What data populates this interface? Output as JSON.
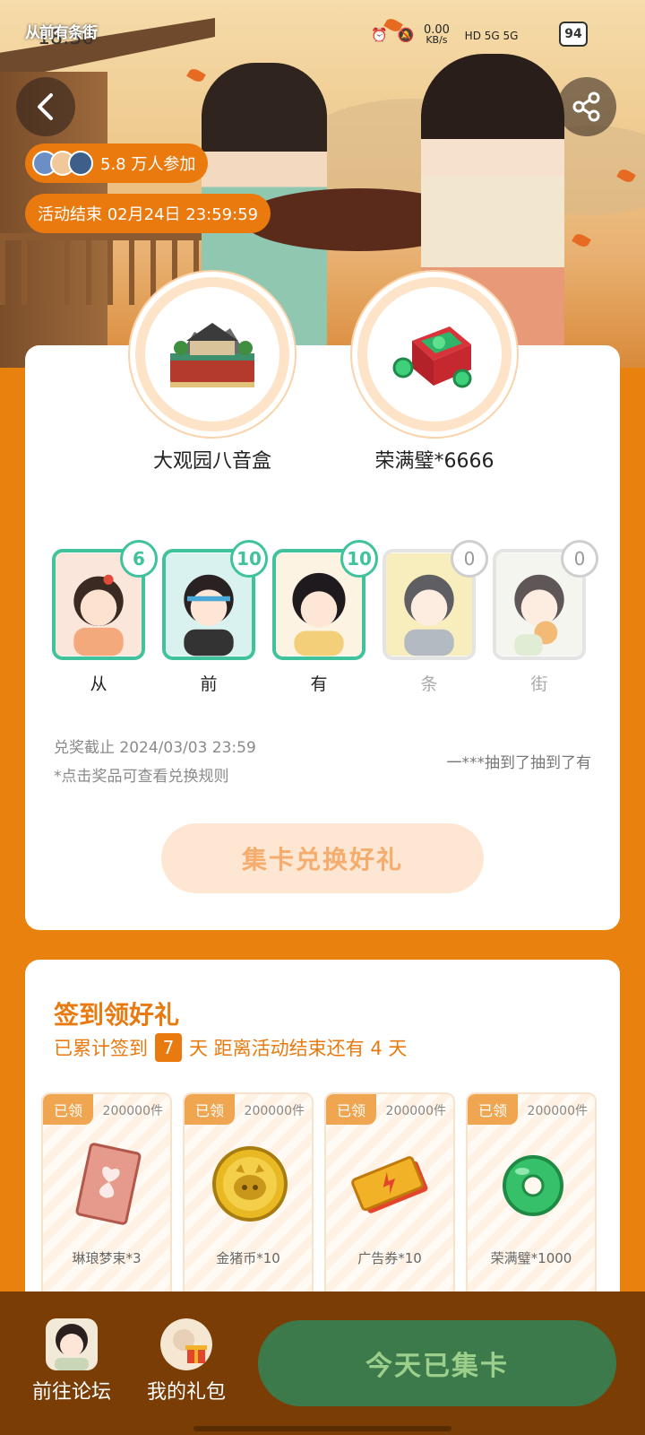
{
  "status_bar": {
    "app_logo": "从前有条街",
    "time": "18:30",
    "net_speed": "0.00",
    "net_unit": "KB/s",
    "signal": "HD 5G 5G",
    "battery": "94"
  },
  "header": {
    "participants": "5.8 万人参加",
    "deadline": "活动结束 02月24日 23:59:59"
  },
  "prizes": [
    {
      "name": "大观园八音盒",
      "icon": "music-box-icon"
    },
    {
      "name": "荣满璧*6666",
      "icon": "jade-chest-icon"
    }
  ],
  "cards": [
    {
      "name": "从",
      "count": "6",
      "collected": true
    },
    {
      "name": "前",
      "count": "10",
      "collected": true
    },
    {
      "name": "有",
      "count": "10",
      "collected": true
    },
    {
      "name": "条",
      "count": "0",
      "collected": false
    },
    {
      "name": "街",
      "count": "0",
      "collected": false
    }
  ],
  "redeem": {
    "deadline": "兑奖截止 2024/03/03 23:59",
    "hint": "*点击奖品可查看兑换规则",
    "ticker": "一***抽到了抽到了有",
    "button": "集卡兑换好礼"
  },
  "signin": {
    "title": "签到领好礼",
    "prefix": "已累计签到",
    "days": "7",
    "suffix": "天  距离活动结束还有 4 天"
  },
  "rewards": [
    {
      "tag": "已领",
      "count": "200000件",
      "name": "琳琅梦束*3",
      "icon": "ticket-icon"
    },
    {
      "tag": "已领",
      "count": "200000件",
      "name": "金猪币*10",
      "icon": "gold-pig-coin-icon"
    },
    {
      "tag": "已领",
      "count": "200000件",
      "name": "广告券*10",
      "icon": "ad-voucher-icon"
    },
    {
      "tag": "已领",
      "count": "200000件",
      "name": "荣满璧*1000",
      "icon": "jade-ring-icon"
    }
  ],
  "bottom": {
    "forum": "前往论坛",
    "gifts": "我的礼包",
    "collect": "今天已集卡"
  },
  "colors": {
    "page_bg": "#e9810f",
    "accent": "#e87a10",
    "collected_border": "#40c29c",
    "bottom_bar": "#7a3d06",
    "collect_button": "#3d7a4b"
  }
}
